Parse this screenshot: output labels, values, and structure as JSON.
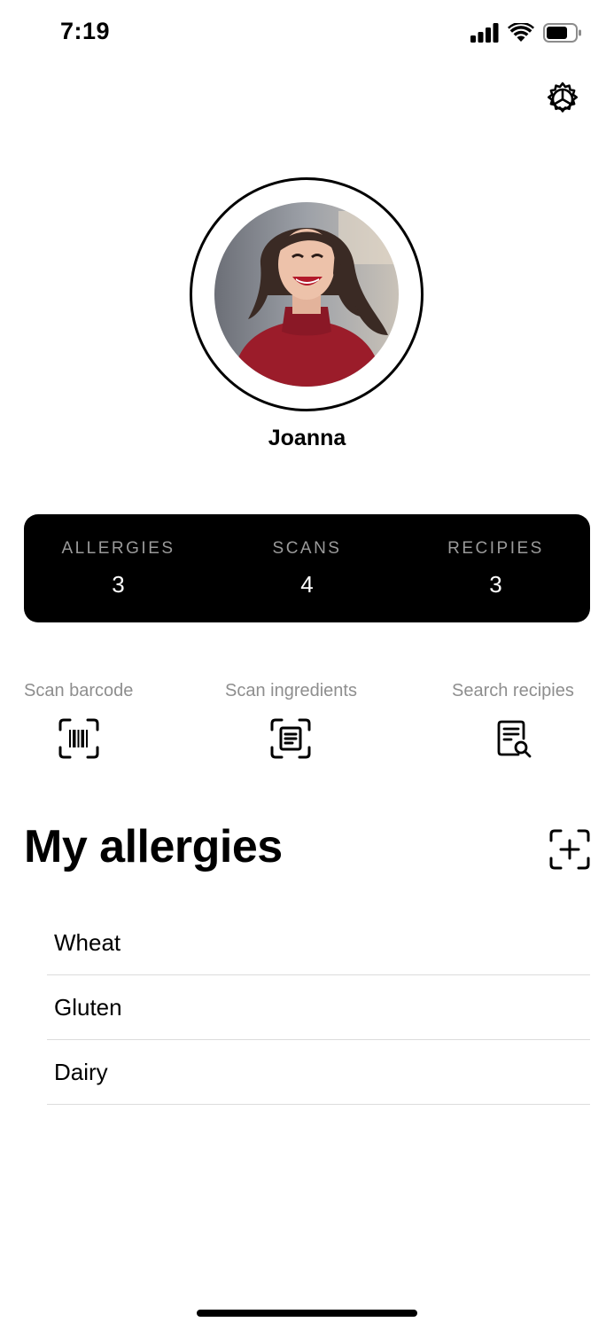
{
  "status_bar": {
    "time": "7:19",
    "icons": [
      "signal-icon",
      "wifi-icon",
      "battery-icon"
    ]
  },
  "header": {
    "settings_icon": "gear-icon"
  },
  "profile": {
    "name": "Joanna"
  },
  "stats": [
    {
      "label": "ALLERGIES",
      "value": "3"
    },
    {
      "label": "SCANS",
      "value": "4"
    },
    {
      "label": "RECIPIES",
      "value": "3"
    }
  ],
  "actions": [
    {
      "label": "Scan barcode",
      "icon": "barcode-scan-icon"
    },
    {
      "label": "Scan ingredients",
      "icon": "document-scan-icon"
    },
    {
      "label": "Search recipies",
      "icon": "document-search-icon"
    }
  ],
  "allergies": {
    "title": "My allergies",
    "add_icon": "add-scan-icon",
    "items": [
      "Wheat",
      "Gluten",
      "Dairy"
    ]
  },
  "colors": {
    "accent": "#000000",
    "card_label": "#9a9a9a",
    "muted_text": "#8e8e8e",
    "divider": "#dcdcdc"
  }
}
